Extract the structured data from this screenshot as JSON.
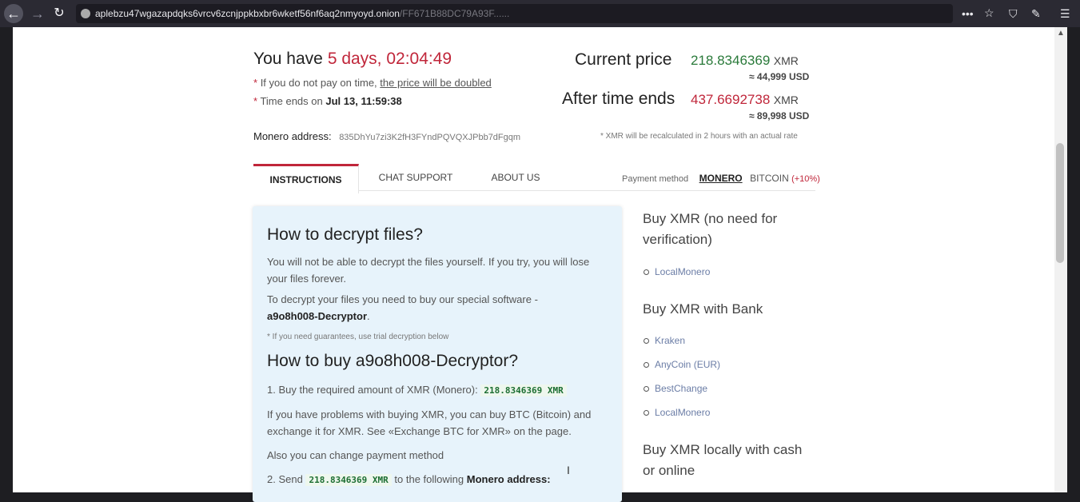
{
  "browser": {
    "url_main": "aplebzu47wgazapdqks6vrcv6zcnjppkbxbr6wketf56nf6aq2nmyoyd.onion",
    "url_rest": "/FF671B88DC79A93F......"
  },
  "header": {
    "you_have": "You have",
    "timer": "5 days, 02:04:49",
    "note1_prefix": "If you do not pay on time,",
    "note1_link": "the price will be doubled",
    "note2_prefix": "Time ends on",
    "note2_date": "Jul 13, 11:59:38",
    "monero_label": "Monero address:",
    "monero_address": "835DhYu7zi3K2fH3FYndPQVQXJPbb7dFgqm",
    "current_label": "Current price",
    "current_value": "218.8346369",
    "current_unit": "XMR",
    "current_usd": "≈ 44,999 USD",
    "after_label": "After time ends",
    "after_value": "437.6692738",
    "after_unit": "XMR",
    "after_usd": "≈ 89,998 USD",
    "recalc_note": "* XMR will be recalculated in 2 hours with an actual rate"
  },
  "tabs": {
    "instructions": "INSTRUCTIONS",
    "chat": "CHAT SUPPORT",
    "about": "ABOUT US",
    "payment_label": "Payment method",
    "monero": "MONERO",
    "bitcoin": "BITCOIN",
    "bitcoin_extra": "(+10%)"
  },
  "instructions": {
    "h1": "How to decrypt files?",
    "p1": "You will not be able to decrypt the files yourself. If you try, you will lose your files forever.",
    "p2_prefix": "To decrypt your files you need to buy our special software -",
    "p2_bold": "a9o8h008-Decryptor",
    "p2_suffix": ".",
    "guarantee": "* If you need guarantees, use trial decryption below",
    "h2": "How to buy a9o8h008-Decryptor?",
    "step1_text": "1.  Buy the required amount of XMR (Monero):",
    "step1_amount": "218.8346369 XMR",
    "p3": "If you have problems with buying XMR, you can buy BTC (Bitcoin) and exchange it for XMR. See «Exchange BTC for XMR» on the page.",
    "p4": "Also you can change payment method",
    "step2_prefix": "2.  Send",
    "step2_amount": "218.8346369 XMR",
    "step2_mid": "to the following",
    "step2_bold": "Monero address:"
  },
  "sidebar": {
    "h1": "Buy XMR (no need for verification)",
    "list1": [
      "LocalMonero"
    ],
    "h2": "Buy XMR with Bank",
    "list2": [
      "Kraken",
      "AnyCoin (EUR)",
      "BestChange",
      "LocalMonero"
    ],
    "h3": "Buy XMR locally with cash or online"
  }
}
